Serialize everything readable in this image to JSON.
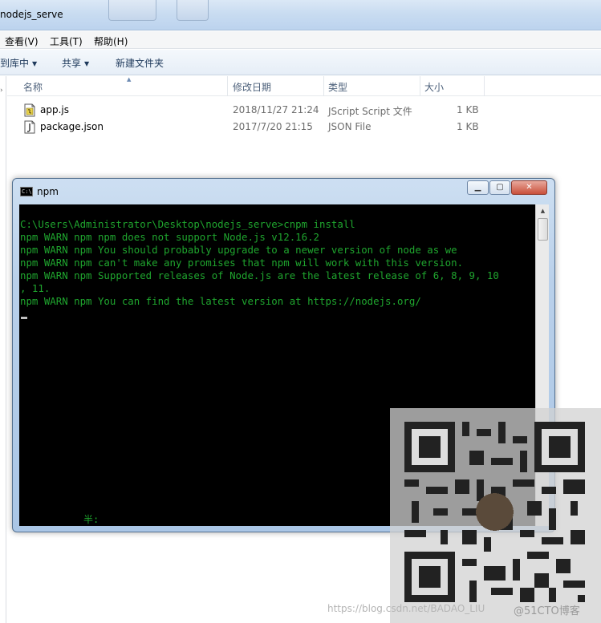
{
  "explorer": {
    "title": "nodejs_serve",
    "menu": [
      "查看(V)",
      "工具(T)",
      "帮助(H)"
    ],
    "toolbar": [
      "到库中",
      "共享",
      "新建文件夹"
    ],
    "columns": [
      "名称",
      "修改日期",
      "类型",
      "大小"
    ],
    "files": [
      {
        "name": "app.js",
        "date": "2018/11/27 21:24",
        "type": "JScript Script 文件",
        "size": "1 KB",
        "icon": "jscript-file-icon"
      },
      {
        "name": "package.json",
        "date": "2017/7/20 21:15",
        "type": "JSON File",
        "size": "1 KB",
        "icon": "json-file-icon"
      }
    ]
  },
  "console": {
    "title": "npm",
    "icon_label": "C:\\.",
    "lines": [
      "C:\\Users\\Administrator\\Desktop\\nodejs_serve>cnpm install",
      "npm WARN npm npm does not support Node.js v12.16.2",
      "npm WARN npm You should probably upgrade to a newer version of node as we",
      "npm WARN npm can't make any promises that npm will work with this version.",
      "npm WARN npm Supported releases of Node.js are the latest release of 6, 8, 9, 10",
      ", 11.",
      "npm WARN npm You can find the latest version at https://nodejs.org/"
    ],
    "ime_status": "半:",
    "text_color": "#1fa52e"
  },
  "watermark": {
    "url": "https://blog.csdn.net/BADAO_LIU",
    "brand": "@51CTO博客"
  }
}
